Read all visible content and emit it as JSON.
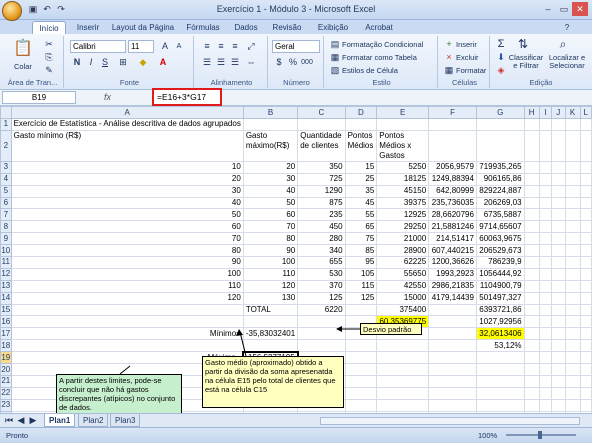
{
  "app": {
    "title": "Exercício 1 - Módulo 3 - Microsoft Excel",
    "tabs": [
      "Início",
      "Inserir",
      "Layout da Página",
      "Fórmulas",
      "Dados",
      "Revisão",
      "Exibição",
      "Acrobat"
    ]
  },
  "ribbon": {
    "paste": "Colar",
    "clipboard": "Área de Tran...",
    "font_name": "Calibri",
    "font_size": "11",
    "font_group": "Fonte",
    "align_group": "Alinhamento",
    "number_format": "Geral",
    "number_group": "Número",
    "cond_format": "Formatação Condicional",
    "table_format": "Formatar como Tabela",
    "cell_styles": "Estilos de Célula",
    "styles_group": "Estilo",
    "insert": "Inserir",
    "delete": "Excluir",
    "format": "Formatar",
    "cells_group": "Células",
    "sort": "Classificar e Filtrar",
    "find": "Localizar e Selecionar",
    "edit_group": "Edição"
  },
  "formula_bar": {
    "cell": "B19",
    "fx": "fx",
    "formula": "=E16+3*G17"
  },
  "columns": [
    "A",
    "B",
    "C",
    "D",
    "E",
    "F",
    "G",
    "H",
    "I",
    "J",
    "K",
    "L"
  ],
  "rows": [
    {
      "n": "1",
      "cells": [
        "Exercício de Estatística - Análise descritiva de dados agrupados",
        "",
        "",
        "",
        "",
        "",
        "",
        "",
        "",
        "",
        "",
        ""
      ]
    },
    {
      "n": "2",
      "cells": [
        "Gasto mínimo (R$)",
        "Gasto máximo(R$)",
        "Quantidade de clientes",
        "Pontos Médios",
        "Pontos Médios x Gastos",
        "",
        "",
        "",
        "",
        "",
        "",
        ""
      ]
    },
    {
      "n": "3",
      "cells": [
        "10",
        "20",
        "350",
        "15",
        "5250",
        "2056,9579",
        "719935,265",
        "",
        "",
        "",
        "",
        ""
      ]
    },
    {
      "n": "4",
      "cells": [
        "20",
        "30",
        "725",
        "25",
        "18125",
        "1249,88394",
        "906165,86",
        "",
        "",
        "",
        "",
        ""
      ]
    },
    {
      "n": "5",
      "cells": [
        "30",
        "40",
        "1290",
        "35",
        "45150",
        "642,80999",
        "829224,887",
        "",
        "",
        "",
        "",
        ""
      ]
    },
    {
      "n": "6",
      "cells": [
        "40",
        "50",
        "875",
        "45",
        "39375",
        "235,736035",
        "206269,03",
        "",
        "",
        "",
        "",
        ""
      ]
    },
    {
      "n": "7",
      "cells": [
        "50",
        "60",
        "235",
        "55",
        "12925",
        "28,6620796",
        "6735,5887",
        "",
        "",
        "",
        "",
        ""
      ]
    },
    {
      "n": "8",
      "cells": [
        "60",
        "70",
        "450",
        "65",
        "29250",
        "21,5881246",
        "9714,65607",
        "",
        "",
        "",
        "",
        ""
      ]
    },
    {
      "n": "9",
      "cells": [
        "70",
        "80",
        "280",
        "75",
        "21000",
        "214,51417",
        "60063,9675",
        "",
        "",
        "",
        "",
        ""
      ]
    },
    {
      "n": "10",
      "cells": [
        "80",
        "90",
        "340",
        "85",
        "28900",
        "607,440215",
        "206529,673",
        "",
        "",
        "",
        "",
        ""
      ]
    },
    {
      "n": "11",
      "cells": [
        "90",
        "100",
        "655",
        "95",
        "62225",
        "1200,36626",
        "786239,9",
        "",
        "",
        "",
        "",
        ""
      ]
    },
    {
      "n": "12",
      "cells": [
        "100",
        "110",
        "530",
        "105",
        "55650",
        "1993,2923",
        "1056444,92",
        "",
        "",
        "",
        "",
        ""
      ]
    },
    {
      "n": "13",
      "cells": [
        "110",
        "120",
        "370",
        "115",
        "42550",
        "2986,21835",
        "1104900,79",
        "",
        "",
        "",
        "",
        ""
      ]
    },
    {
      "n": "14",
      "cells": [
        "120",
        "130",
        "125",
        "125",
        "15000",
        "4179,14439",
        "501497,327",
        "",
        "",
        "",
        "",
        ""
      ]
    },
    {
      "n": "15",
      "cells": [
        "",
        "TOTAL",
        "6220",
        "",
        "375400",
        "",
        "6393721,86",
        "",
        "",
        "",
        "",
        ""
      ]
    },
    {
      "n": "16",
      "cells": [
        "",
        "",
        "",
        "",
        "60,35369775",
        "",
        "1027,92956",
        "",
        "",
        "",
        "",
        ""
      ]
    },
    {
      "n": "17",
      "cells": [
        "Mínimo=",
        "-35,83032401",
        "",
        "",
        "",
        "",
        "32,0613406",
        "",
        "",
        "",
        "",
        ""
      ]
    },
    {
      "n": "18",
      "cells": [
        "",
        "",
        "",
        "",
        "",
        "",
        "53,12%",
        "",
        "",
        "",
        "",
        ""
      ]
    },
    {
      "n": "19",
      "cells": [
        "Máximo=",
        "156,5377195",
        "",
        "",
        "",
        "",
        "",
        "",
        "",
        "",
        "",
        ""
      ]
    },
    {
      "n": "20",
      "cells": [
        "",
        "",
        "",
        "",
        "",
        "",
        "",
        "",
        "",
        "",
        "",
        ""
      ]
    },
    {
      "n": "21",
      "cells": [
        "",
        "",
        "",
        "",
        "",
        "",
        "",
        "",
        "",
        "",
        "",
        ""
      ]
    },
    {
      "n": "22",
      "cells": [
        "",
        "",
        "",
        "",
        "",
        "",
        "",
        "",
        "",
        "",
        "",
        ""
      ]
    },
    {
      "n": "23",
      "cells": [
        "",
        "",
        "",
        "",
        "",
        "",
        "",
        "",
        "",
        "",
        "",
        ""
      ]
    },
    {
      "n": "24",
      "cells": [
        "",
        "",
        "",
        "",
        "",
        "",
        "",
        "",
        "",
        "",
        "",
        ""
      ]
    }
  ],
  "notes": {
    "desvio": "Desvio padrão",
    "limits": "A partir destes limites, pode-se concluir que não há gastos discrepantes (atípicos) no conjunto de dados.",
    "gasto": "Gasto médio (aproximado) obtido a partir da divisão da soma apresenatda na célula E15 pelo total de clientes que está na célula C15"
  },
  "sheets": [
    "Plan1",
    "Plan2",
    "Plan3"
  ],
  "status": {
    "ready": "Pronto",
    "zoom": "100%"
  },
  "colors": {
    "yellow": "#ffff00",
    "note_green": "#c6efce",
    "note_yellow": "#ffffc0",
    "formula_box": "#e01b1b"
  }
}
